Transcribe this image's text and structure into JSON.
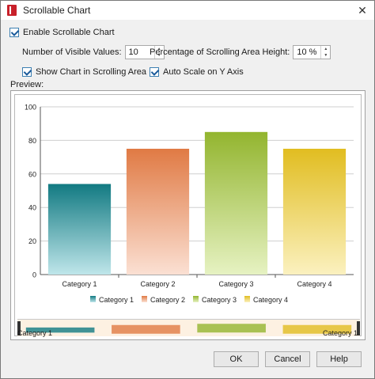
{
  "window": {
    "title": "Scrollable Chart",
    "close_glyph": "✕"
  },
  "options": {
    "enable_label": "Enable Scrollable Chart",
    "enable_checked": true,
    "visible_values_label": "Number of Visible Values:",
    "visible_values": "10",
    "scroll_height_label": "Percentage of Scrolling Area Height:",
    "scroll_height": "10 %",
    "show_chart_label": "Show Chart in Scrolling Area",
    "show_chart_checked": true,
    "auto_scale_label": "Auto Scale on Y Axis",
    "auto_scale_checked": true
  },
  "preview": {
    "label": "Preview:",
    "scroll_left_label": "Category 1",
    "scroll_right_label": "Category 1"
  },
  "buttons": {
    "ok": "OK",
    "cancel": "Cancel",
    "help": "Help"
  },
  "colors": {
    "series": [
      "#127a82",
      "#e07a44",
      "#93b52f",
      "#e1bd20"
    ],
    "series_light": [
      "#bfe6ea",
      "#fbe0d3",
      "#e6f2c2",
      "#fbf1bf"
    ]
  },
  "chart_data": {
    "type": "bar",
    "categories": [
      "Category 1",
      "Category 2",
      "Category 3",
      "Category 4"
    ],
    "values": [
      54,
      75,
      85,
      75
    ],
    "ylim": [
      0,
      100
    ],
    "yticks": [
      "0",
      "20",
      "40",
      "60",
      "80",
      "100"
    ],
    "legend": [
      "Category 1",
      "Category 2",
      "Category 3",
      "Category 4"
    ],
    "legend_position": "bottom",
    "grid": true
  }
}
